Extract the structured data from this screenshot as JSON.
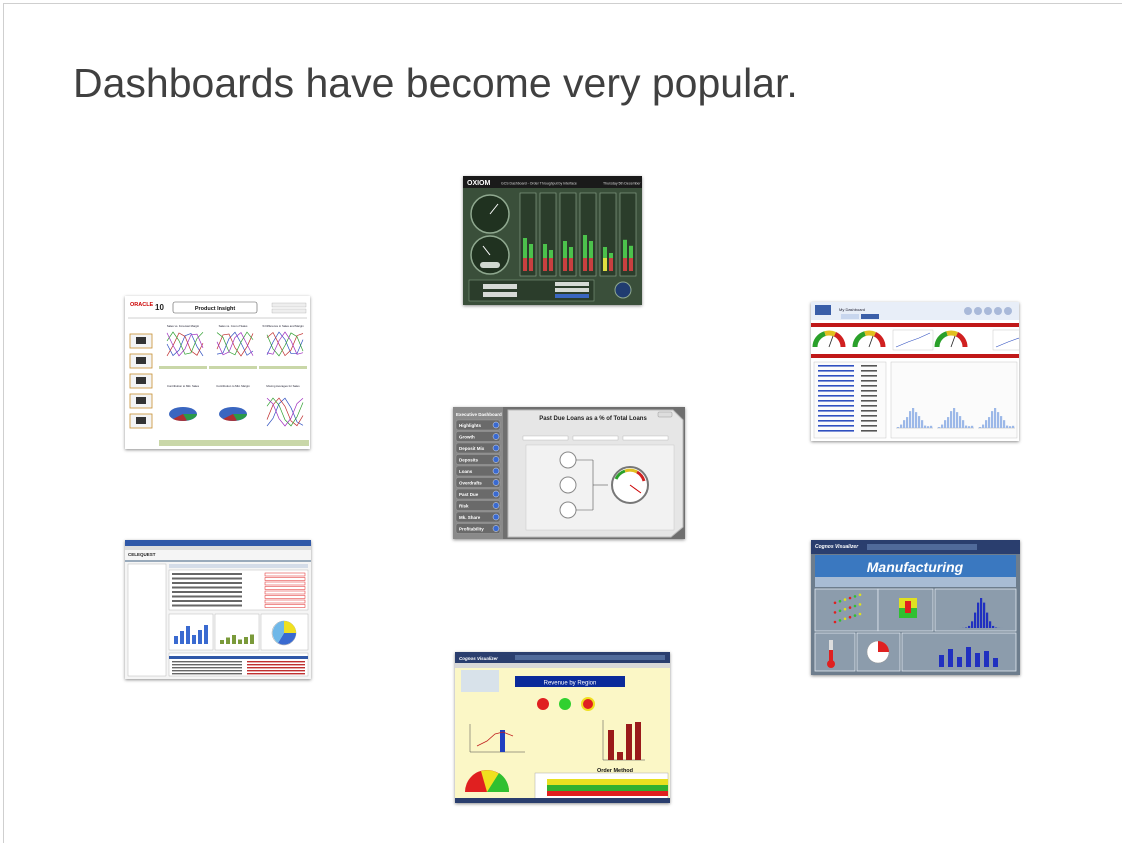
{
  "slide": {
    "title": "Dashboards have become very popular."
  },
  "thumbnails": {
    "oxiom": {
      "brand": "OXIOM",
      "header": "GCS Dashboard - Order Throughput by Interface",
      "date": "Thursday 5th December"
    },
    "oracle": {
      "brand": "ORACLE",
      "edition": "10",
      "title": "Product Insight",
      "charts": [
        "Sales vs. Forecast Margin",
        "Sales vs. Cost of Sales",
        "% Difference in Sales and Margin",
        "Contribution to Mkt. Sales",
        "Contribution to Mkt. Margin",
        "Moving Averages for Sales"
      ]
    },
    "executive": {
      "label": "Executive Dashboard",
      "title": "Past Due Loans as a % of Total Loans",
      "nav": [
        "Highlights",
        "Growth",
        "Deposit Mix",
        "Deposits",
        "Loans",
        "Overdrafts",
        "Past Due",
        "Risk",
        "Mk. Share",
        "Profitability"
      ]
    },
    "redgauges": {
      "brand": "My Dashboard"
    },
    "celequest": {
      "brand": "CELEQUEST"
    },
    "manufacturing": {
      "brand": "Cognos Visualizer",
      "title": "Manufacturing"
    },
    "revenue": {
      "brand": "Cognos Visualizer",
      "title": "Revenue by Region",
      "sub": "Order Method"
    }
  }
}
